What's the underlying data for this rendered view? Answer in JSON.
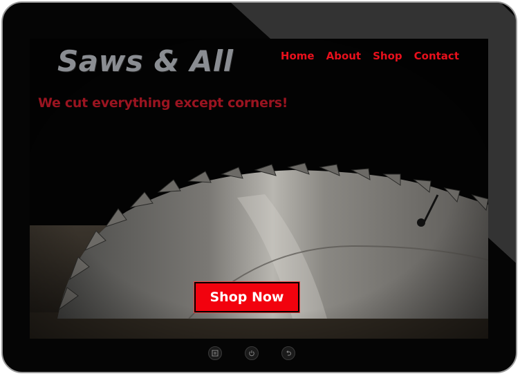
{
  "site": {
    "logo": "Saws & All",
    "tagline": "We cut everything except corners!",
    "cta_label": "Shop Now"
  },
  "nav": {
    "items": [
      {
        "label": "Home"
      },
      {
        "label": "About"
      },
      {
        "label": "Shop"
      },
      {
        "label": "Contact"
      }
    ]
  },
  "hardware_buttons": {
    "menu_icon": "menu-icon",
    "power_icon": "power-icon",
    "back_icon": "back-icon"
  },
  "colors": {
    "nav_red": "#e8101c",
    "tagline_red": "#9a1420",
    "cta_red": "#f2020e",
    "logo_gray": "#8a8d92"
  }
}
